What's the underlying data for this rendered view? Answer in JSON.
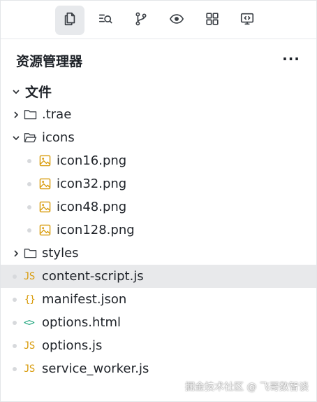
{
  "topbar": {
    "buttons": [
      {
        "icon": "explorer-icon",
        "active": true
      },
      {
        "icon": "search-icon",
        "active": false
      },
      {
        "icon": "source-control-icon",
        "active": false
      },
      {
        "icon": "preview-icon",
        "active": false
      },
      {
        "icon": "extensions-icon",
        "active": false
      },
      {
        "icon": "remote-icon",
        "active": false
      }
    ]
  },
  "header": {
    "title": "资源管理器",
    "more": "···"
  },
  "tree": {
    "root": {
      "label": "文件",
      "expanded": true
    },
    "items": [
      {
        "label": ".trae",
        "type": "folder",
        "expanded": false
      },
      {
        "label": "icons",
        "type": "folder",
        "expanded": true
      },
      {
        "label": "icon16.png",
        "type": "image"
      },
      {
        "label": "icon32.png",
        "type": "image"
      },
      {
        "label": "icon48.png",
        "type": "image"
      },
      {
        "label": "icon128.png",
        "type": "image"
      },
      {
        "label": "styles",
        "type": "folder",
        "expanded": false
      },
      {
        "label": "content-script.js",
        "type": "js",
        "selected": true
      },
      {
        "label": "manifest.json",
        "type": "json"
      },
      {
        "label": "options.html",
        "type": "html"
      },
      {
        "label": "options.js",
        "type": "js"
      },
      {
        "label": "service_worker.js",
        "type": "js"
      }
    ],
    "badges": {
      "js": "JS",
      "json": "{}",
      "html": "<>"
    }
  },
  "watermark": "掘金技术社区 @ 飞哥数智谈",
  "colors": {
    "selected_bg": "#e8e9eb",
    "active_button_bg": "#e7e9ec",
    "js_accent": "#d89b0b",
    "html_accent": "#1aa37a",
    "image_accent": "#d89b0b"
  }
}
